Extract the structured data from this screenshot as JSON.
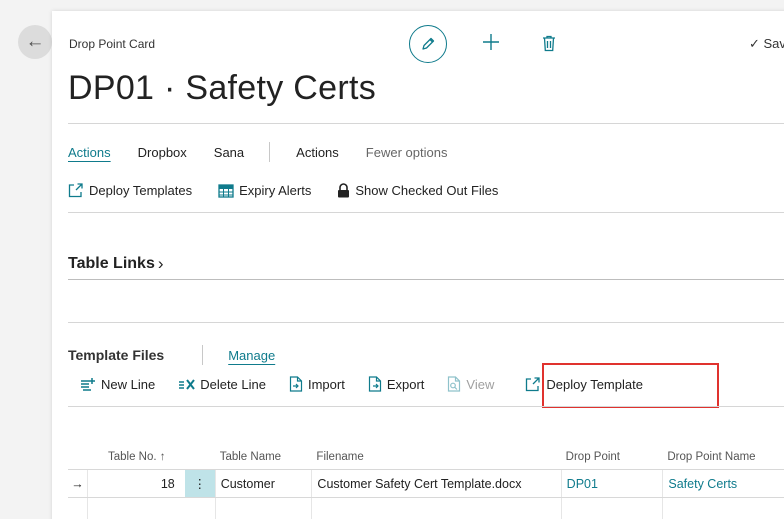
{
  "header": {
    "caption": "Drop Point Card",
    "title": "DP01 · Safety Certs",
    "save_label": "✓ Sav"
  },
  "tabs": [
    {
      "label": "Actions"
    },
    {
      "label": "Dropbox"
    },
    {
      "label": "Sana"
    },
    {
      "label": "Actions"
    },
    {
      "label": "Fewer options"
    }
  ],
  "actions": {
    "deploy_templates": "Deploy Templates",
    "expiry_alerts": "Expiry Alerts",
    "show_checked_out": "Show Checked Out Files"
  },
  "fasttab": {
    "label": "Table Links",
    "chevron": "›"
  },
  "template_files": {
    "title": "Template Files",
    "manage": "Manage",
    "actions": {
      "new_line": "New Line",
      "delete_line": "Delete Line",
      "import": "Import",
      "export": "Export",
      "view": "View",
      "deploy_template": "Deploy Template"
    },
    "columns": {
      "table_no": "Table No. ↑",
      "table_name": "Table Name",
      "filename": "Filename",
      "drop_point": "Drop Point",
      "drop_point_name": "Drop Point Name"
    },
    "rows": [
      {
        "arrow": "→",
        "table_no": "18",
        "menu": "⋮",
        "table_name": "Customer",
        "filename": "Customer Safety Cert Template.docx",
        "drop_point": "DP01",
        "drop_point_name": "Safety Certs"
      }
    ]
  },
  "colors": {
    "accent": "#0f7b8c",
    "highlight": "#e0322e"
  }
}
